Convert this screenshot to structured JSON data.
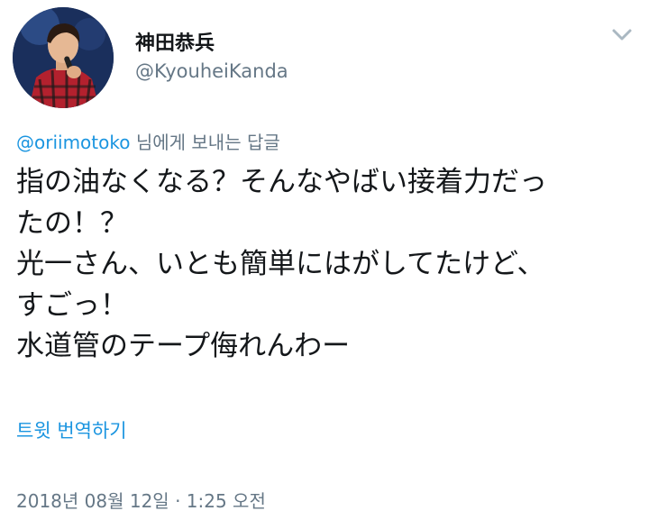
{
  "author": {
    "display_name": "神田恭兵",
    "handle": "@KyouheiKanda",
    "avatar_icon": "profile-photo"
  },
  "menu": {
    "icon": "chevron-down-icon"
  },
  "reply": {
    "mention": "@oriimotoko",
    "suffix": " 님에게 보내는 답글"
  },
  "tweet": {
    "lines": [
      "指の油なくなる？そんなやばい接着力だっ",
      "たの！？",
      "光一さん、いとも簡単にはがしてたけど、",
      "すごっ！",
      "水道管のテープ侮れんわー"
    ]
  },
  "translate_label": "트윗 번역하기",
  "timestamp": "2018년 08월 12일 · 1:25 오전",
  "colors": {
    "link": "#1b95e0",
    "secondary_text": "#657786",
    "primary_text": "#14171a"
  }
}
